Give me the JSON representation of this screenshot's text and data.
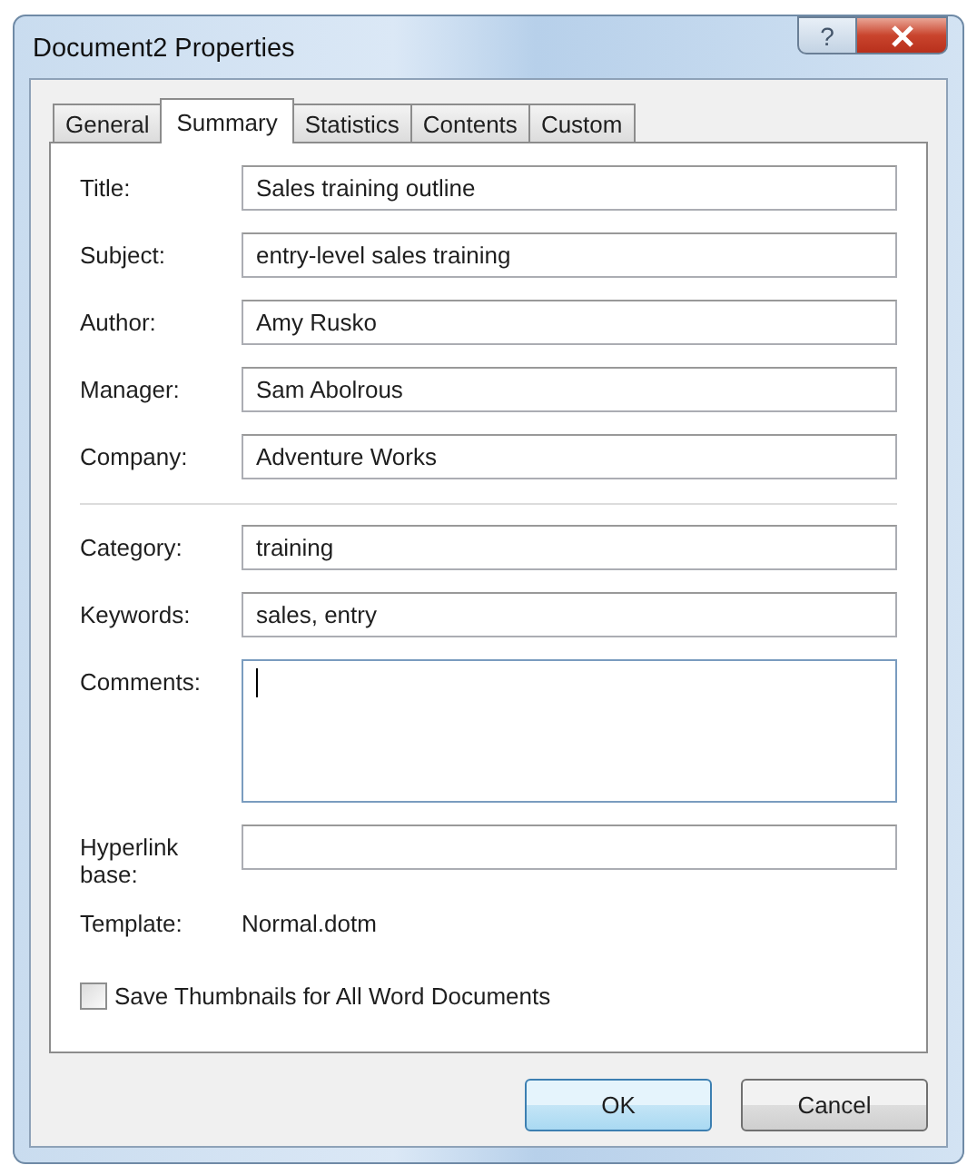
{
  "window": {
    "title": "Document2 Properties",
    "help_glyph": "?"
  },
  "tabs": [
    {
      "label": "General",
      "selected": false
    },
    {
      "label": "Summary",
      "selected": true
    },
    {
      "label": "Statistics",
      "selected": false
    },
    {
      "label": "Contents",
      "selected": false
    },
    {
      "label": "Custom",
      "selected": false
    }
  ],
  "sections": [
    {
      "fields": [
        {
          "kind": "field",
          "label": "Title:",
          "value": "Sales training outline",
          "focused": false
        },
        {
          "kind": "field",
          "label": "Subject:",
          "value": "entry-level sales training",
          "focused": false
        },
        {
          "kind": "field",
          "label": "Author:",
          "value": "Amy Rusko",
          "focused": false
        },
        {
          "kind": "field",
          "label": "Manager:",
          "value": "Sam Abolrous",
          "focused": false
        },
        {
          "kind": "field",
          "label": "Company:",
          "value": "Adventure Works",
          "focused": false
        }
      ]
    },
    {
      "fields": [
        {
          "kind": "field",
          "label": "Category:",
          "value": "training",
          "focused": false
        },
        {
          "kind": "field",
          "label": "Keywords:",
          "value": "sales, entry",
          "focused": false
        },
        {
          "kind": "textarea",
          "label": "Comments:",
          "focused": true
        },
        {
          "kind": "field",
          "label": "Hyperlink base:",
          "focused": false
        },
        {
          "kind": "text",
          "label": "Template:",
          "value": "Normal.dotm"
        }
      ]
    }
  ],
  "checkbox": {
    "label": "Save Thumbnails for All Word Documents",
    "checked": false
  },
  "buttons": [
    {
      "label": "OK",
      "default": true
    },
    {
      "label": "Cancel",
      "default": false
    }
  ]
}
